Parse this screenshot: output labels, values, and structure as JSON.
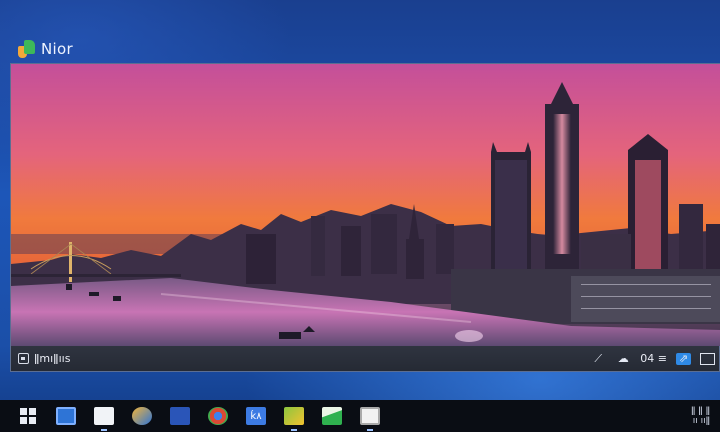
{
  "app": {
    "name": "Nior",
    "icon": "app-logo-icon"
  },
  "viewer": {
    "photo_alt": "city skyline at sunset",
    "status_text": "ǁmıǁııs",
    "toolbar": {
      "zoom_label": "04 ≡",
      "buttons": [
        "crop-icon",
        "cloud-icon",
        "share-icon",
        "fullscreen-icon"
      ]
    }
  },
  "taskbar": {
    "items": [
      {
        "name": "start-icon",
        "color": "#e8ecf4"
      },
      {
        "name": "calendar-icon",
        "color": "#2e74d6"
      },
      {
        "name": "file-explorer-icon",
        "color": "#f1f3f7"
      },
      {
        "name": "edge-browser-icon",
        "color": "#f3b53a"
      },
      {
        "name": "facebook-icon",
        "color": "#2a55b8"
      },
      {
        "name": "chrome-icon",
        "color": "#d94a34"
      },
      {
        "name": "store-icon",
        "color": "#3d7be3"
      },
      {
        "name": "photos-icon",
        "color": "#8cc63f"
      },
      {
        "name": "maps-icon",
        "color": "#2fb14f"
      },
      {
        "name": "mail-icon",
        "color": "#f2f2f2"
      }
    ],
    "store_label": "ḱ٨",
    "tray_text_top": "ǁ ǁ ǁ",
    "tray_text_bottom": "ıı ııǁ"
  },
  "colors": {
    "accent": "#2f8ae6",
    "desktop": "#1d56b8",
    "taskbar": "#0a0d14"
  }
}
